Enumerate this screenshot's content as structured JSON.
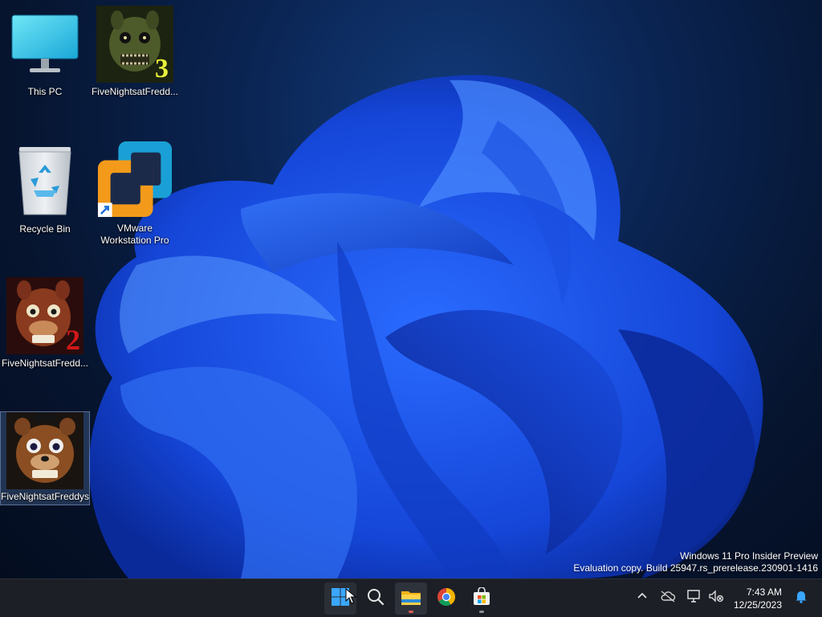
{
  "desktop": {
    "icons": [
      {
        "label": "This PC",
        "icon": "this-pc-icon"
      },
      {
        "label": "FiveNightsatFredd...",
        "icon": "fnaf3-icon",
        "badge": "3"
      },
      {
        "label": "Recycle Bin",
        "icon": "recycle-bin-icon"
      },
      {
        "label": "VMware\nWorkstation Pro",
        "icon": "vmware-icon"
      },
      {
        "label": "FiveNightsatFredd...",
        "icon": "fnaf2-icon",
        "badge": "2"
      },
      {
        "label": "FiveNightsatFreddys",
        "icon": "fnaf1-icon"
      }
    ],
    "watermark": {
      "line1": "Windows 11 Pro Insider Preview",
      "line2": "Evaluation copy. Build 25947.rs_prerelease.230901-1416"
    }
  },
  "taskbar": {
    "apps": [
      {
        "icon": "windows-start-icon"
      },
      {
        "icon": "search-icon"
      },
      {
        "icon": "file-explorer-icon"
      },
      {
        "icon": "chrome-icon"
      },
      {
        "icon": "microsoft-store-icon"
      }
    ],
    "tray": {
      "icons": [
        "chevron-up-icon",
        "cloud-offline-icon",
        "network-icon",
        "volume-muted-icon",
        "notification-bell-icon"
      ],
      "time": "7:43 AM",
      "date": "12/25/2023"
    }
  },
  "colors": {
    "accent": "#1f6fff",
    "taskbar": "#1c1f26",
    "wallpaper_bg": "#06142e"
  }
}
